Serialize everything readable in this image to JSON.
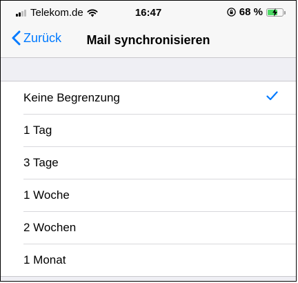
{
  "status_bar": {
    "carrier": "Telekom.de",
    "time": "16:47",
    "battery_percent": "68 %",
    "battery_level": 0.68,
    "signal_bars_active": 2,
    "icons": [
      "signal-icon",
      "wifi-icon",
      "rotation-lock-icon",
      "battery-icon"
    ]
  },
  "nav": {
    "back_label": "Zurück",
    "title": "Mail synchronisieren"
  },
  "options": {
    "items": [
      {
        "label": "Keine Begrenzung",
        "selected": true
      },
      {
        "label": "1 Tag",
        "selected": false
      },
      {
        "label": "3 Tage",
        "selected": false
      },
      {
        "label": "1 Woche",
        "selected": false
      },
      {
        "label": "2 Wochen",
        "selected": false
      },
      {
        "label": "1 Monat",
        "selected": false
      }
    ]
  },
  "colors": {
    "accent": "#007aff",
    "battery_charging": "#4cd964",
    "group_background": "#efeff4"
  }
}
